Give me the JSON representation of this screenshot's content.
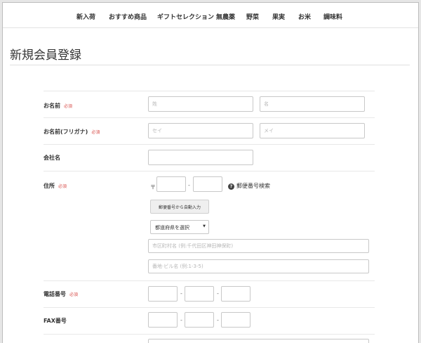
{
  "nav": {
    "items": [
      {
        "label": "新入荷"
      },
      {
        "label": "おすすめ商品"
      },
      {
        "label": "ギフトセレクション"
      },
      {
        "label": "無農薬"
      },
      {
        "label": "野菜"
      },
      {
        "label": "果実"
      },
      {
        "label": "お米"
      },
      {
        "label": "調味料"
      }
    ]
  },
  "page": {
    "title": "新規会員登録"
  },
  "form": {
    "required_text": "必須",
    "name": {
      "label": "お名前",
      "last_placeholder": "姓",
      "first_placeholder": "名"
    },
    "kana": {
      "label": "お名前(フリガナ)",
      "last_placeholder": "セイ",
      "first_placeholder": "メイ"
    },
    "company": {
      "label": "会社名"
    },
    "address": {
      "label": "住所",
      "zip_mark": "〒",
      "zip_separator": "-",
      "help_icon": "?",
      "zip_search_link": "郵便番号検索",
      "zip_auto_button": "郵便番号から自動入力",
      "prefecture_select": "都道府県を選択",
      "caret_icon": "▼",
      "city_placeholder": "市区町村名 (例:千代田区神田神保町)",
      "street_placeholder": "番地·ビル名 (例:1-3-5)"
    },
    "phone": {
      "label": "電話番号",
      "separator": "-"
    },
    "fax": {
      "label": "FAX番号",
      "separator": "-"
    }
  }
}
